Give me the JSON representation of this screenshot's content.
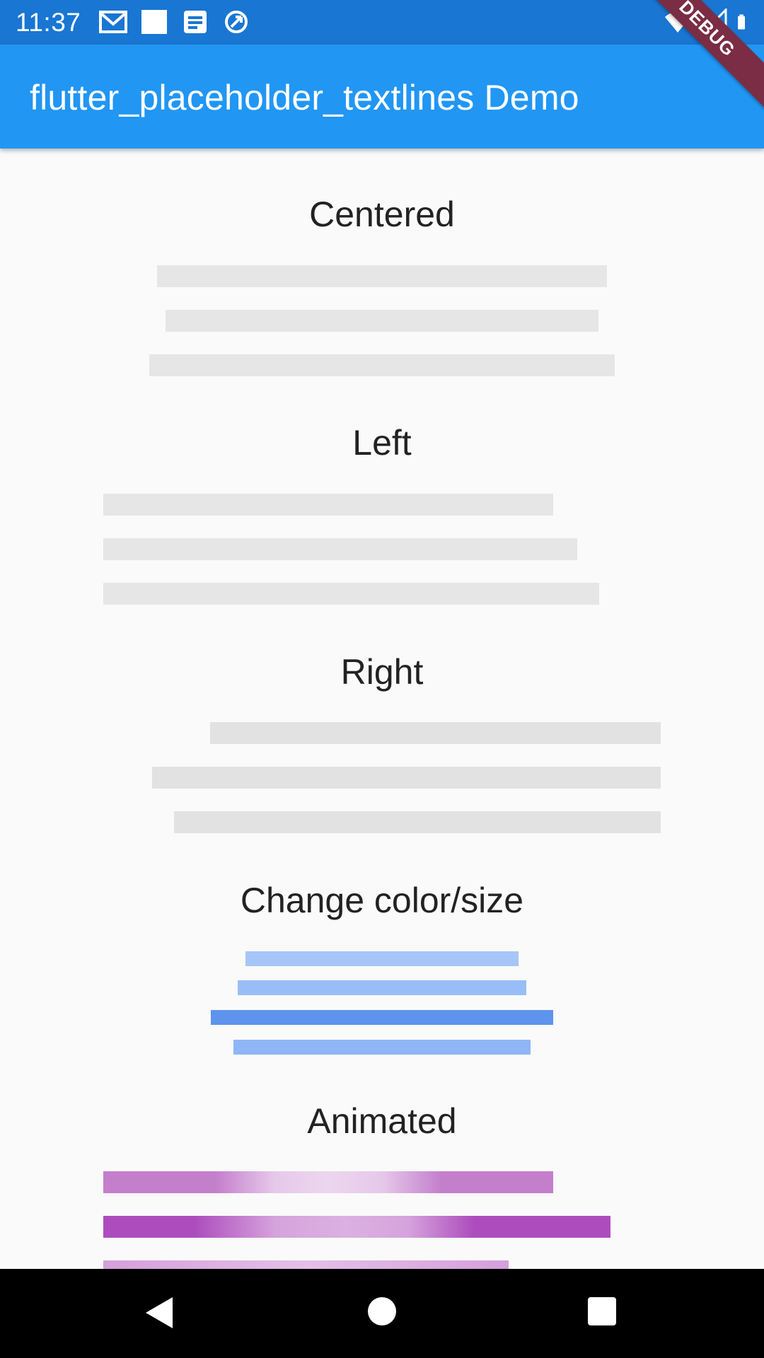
{
  "status_bar": {
    "time": "11:37",
    "left_icons": [
      "gmail-icon",
      "blank-notification-icon",
      "document-icon",
      "sync-icon"
    ],
    "right_icons": [
      "wifi-icon",
      "cell-signal-icon",
      "battery-icon"
    ],
    "background": "#1976d2"
  },
  "app_bar": {
    "title": "flutter_placeholder_textlines Demo",
    "background": "#2196f3"
  },
  "debug_banner": {
    "label": "DEBUG",
    "color": "#7a2d44"
  },
  "sections": {
    "centered": {
      "title": "Centered",
      "line_color": "#e6e6e6",
      "line_count": 3
    },
    "left": {
      "title": "Left",
      "line_color": "#e6e6e6",
      "line_count": 3
    },
    "right": {
      "title": "Right",
      "line_color": "#e2e2e2",
      "line_count": 3
    },
    "change_color_size": {
      "title": "Change color/size",
      "line_colors": [
        "#a7c6f8",
        "#99bef7",
        "#5e93ee",
        "#8fb6f6"
      ],
      "line_count": 4
    },
    "animated": {
      "title": "Animated",
      "line_colors": [
        "#c47fcc",
        "#ad4dbd",
        "#d59fdb"
      ],
      "highlight_color": "#ecd6ee",
      "line_count": 3
    }
  },
  "nav_bar": {
    "buttons": [
      "back-icon",
      "home-icon",
      "recents-icon"
    ]
  }
}
